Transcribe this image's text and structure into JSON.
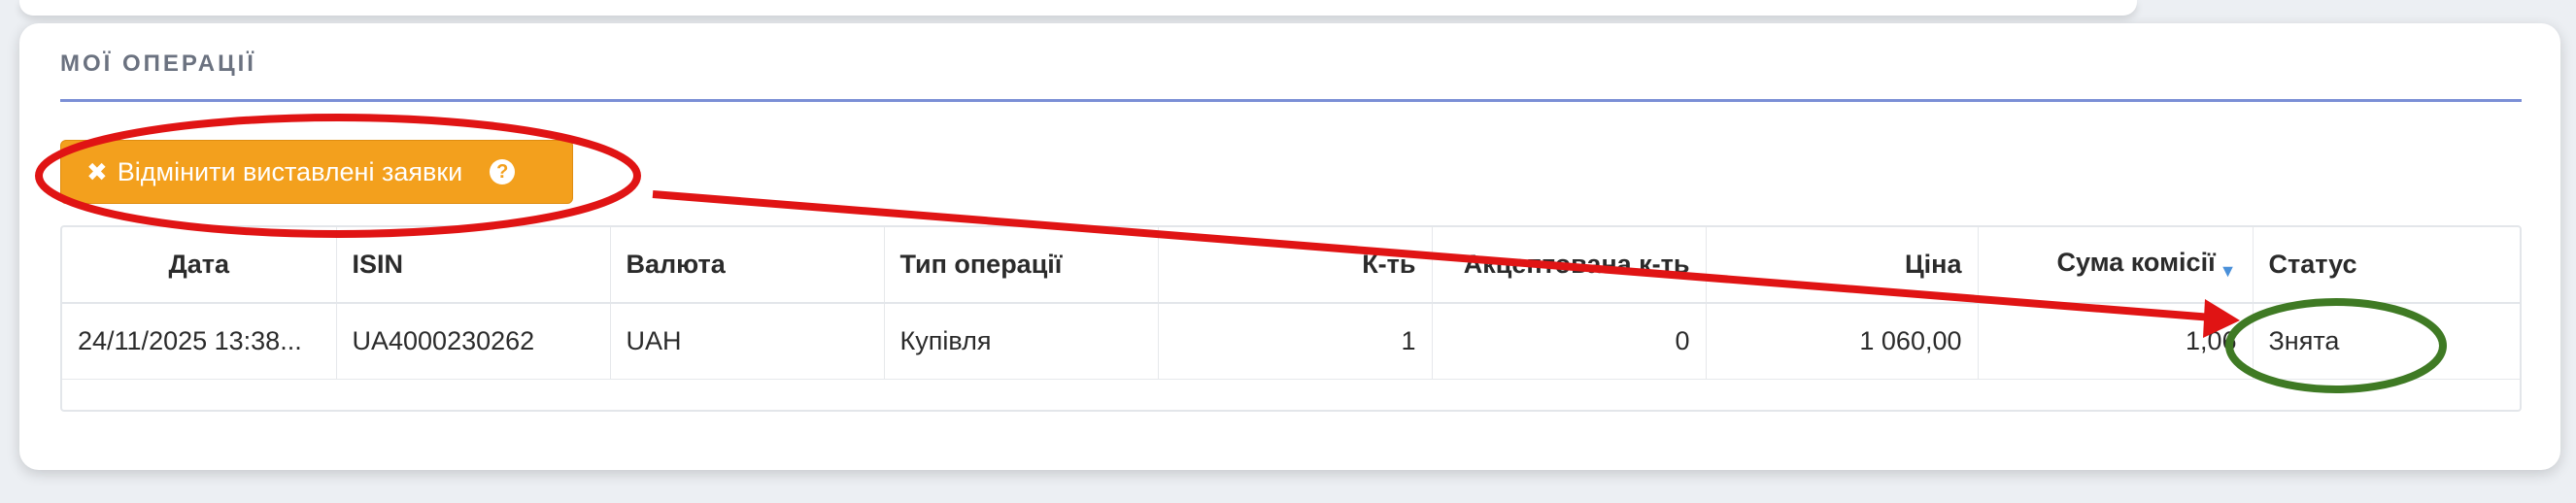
{
  "section": {
    "title": "МОЇ ОПЕРАЦІЇ"
  },
  "actions": {
    "cancel_label": "Відмінити виставлені заявки",
    "cancel_icon": "times-icon",
    "help_icon": "question-circle-icon",
    "button_color": "#f3a01d"
  },
  "table": {
    "columns": [
      "Дата",
      "ISIN",
      "Валюта",
      "Тип операції",
      "К-ть",
      "Акцептована к-ть",
      "Ціна",
      "Сума комісії",
      "Статус"
    ],
    "sorted_column": "Сума комісії",
    "rows": [
      [
        "24/11/2025 13:38...",
        "UA4000230262",
        "UAH",
        "Купівля",
        "1",
        "0",
        "1 060,00",
        "1,06",
        "Знята"
      ]
    ]
  },
  "annotations": {
    "highlight_color": "#e01414",
    "status_circle_color": "#3f7a24"
  }
}
